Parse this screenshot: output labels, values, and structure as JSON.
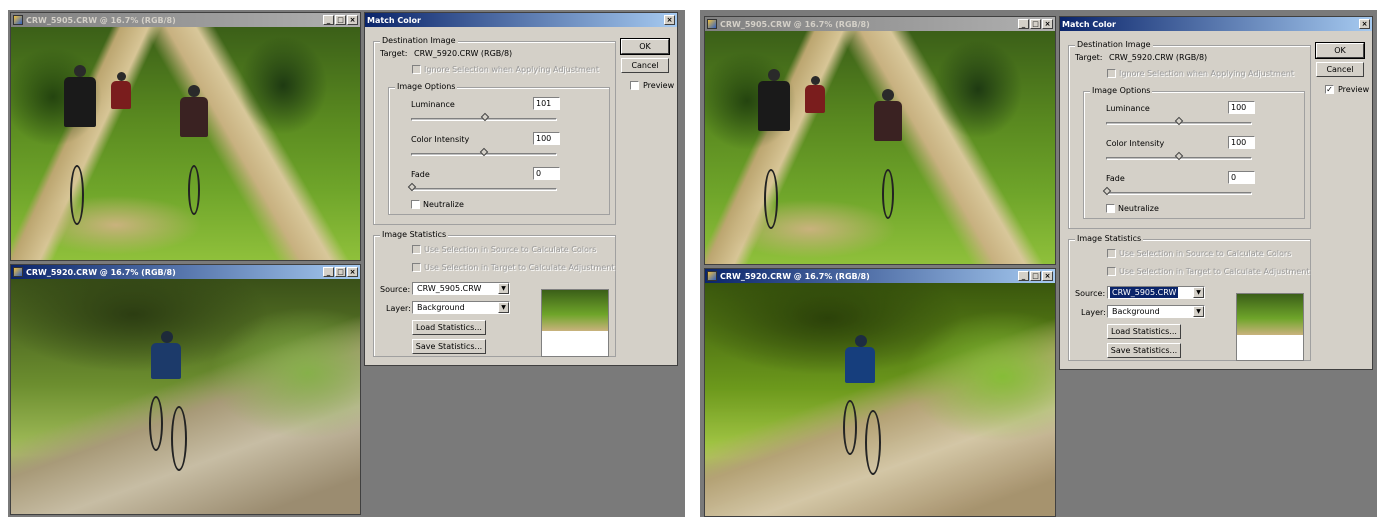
{
  "windows": {
    "top_title": "CRW_5905.CRW @ 16.7% (RGB/8)",
    "bottom_title": "CRW_5920.CRW @ 16.7% (RGB/8)",
    "min": "_",
    "max": "□",
    "close": "×"
  },
  "left_dialog": {
    "title": "Match Color",
    "destination": {
      "legend": "Destination Image",
      "target_label": "Target:",
      "target_value": "CRW_5920.CRW (RGB/8)",
      "ignore_selection": "Ignore Selection when Applying Adjustment"
    },
    "image_options": {
      "legend": "Image Options",
      "luminance_label": "Luminance",
      "luminance_value": "101",
      "luminance_level": 0.505,
      "color_intensity_label": "Color Intensity",
      "color_intensity_value": "100",
      "color_intensity_level": 0.5,
      "fade_label": "Fade",
      "fade_value": "0",
      "fade_level": 0,
      "neutralize_label": "Neutralize"
    },
    "image_statistics": {
      "legend": "Image Statistics",
      "use_source": "Use Selection in Source to Calculate Colors",
      "use_target": "Use Selection in Target to Calculate Adjustment",
      "source_label": "Source:",
      "source_value": "CRW_5905.CRW",
      "layer_label": "Layer:",
      "layer_value": "Background",
      "load_stats": "Load Statistics...",
      "save_stats": "Save Statistics..."
    },
    "ok": "OK",
    "cancel": "Cancel",
    "preview_label": "Preview",
    "preview_checked": false
  },
  "right_dialog": {
    "title": "Match Color",
    "destination": {
      "legend": "Destination Image",
      "target_label": "Target:",
      "target_value": "CRW_5920.CRW (RGB/8)",
      "ignore_selection": "Ignore Selection when Applying Adjustment"
    },
    "image_options": {
      "legend": "Image Options",
      "luminance_label": "Luminance",
      "luminance_value": "100",
      "luminance_level": 0.5,
      "color_intensity_label": "Color Intensity",
      "color_intensity_value": "100",
      "color_intensity_level": 0.5,
      "fade_label": "Fade",
      "fade_value": "0",
      "fade_level": 0,
      "neutralize_label": "Neutralize"
    },
    "image_statistics": {
      "legend": "Image Statistics",
      "use_source": "Use Selection in Source to Calculate Colors",
      "use_target": "Use Selection in Target to Calculate Adjustment",
      "source_label": "Source:",
      "source_value": "CRW_5905.CRW",
      "layer_label": "Layer:",
      "layer_value": "Background",
      "load_stats": "Load Statistics...",
      "save_stats": "Save Statistics..."
    },
    "ok": "OK",
    "cancel": "Cancel",
    "preview_label": "Preview",
    "preview_checked": true,
    "check_mark": "✓"
  },
  "colors": {
    "titlebar_active": "#0a246a",
    "dialog_face": "#d4d0c8",
    "workspace": "#7a7a7a"
  }
}
